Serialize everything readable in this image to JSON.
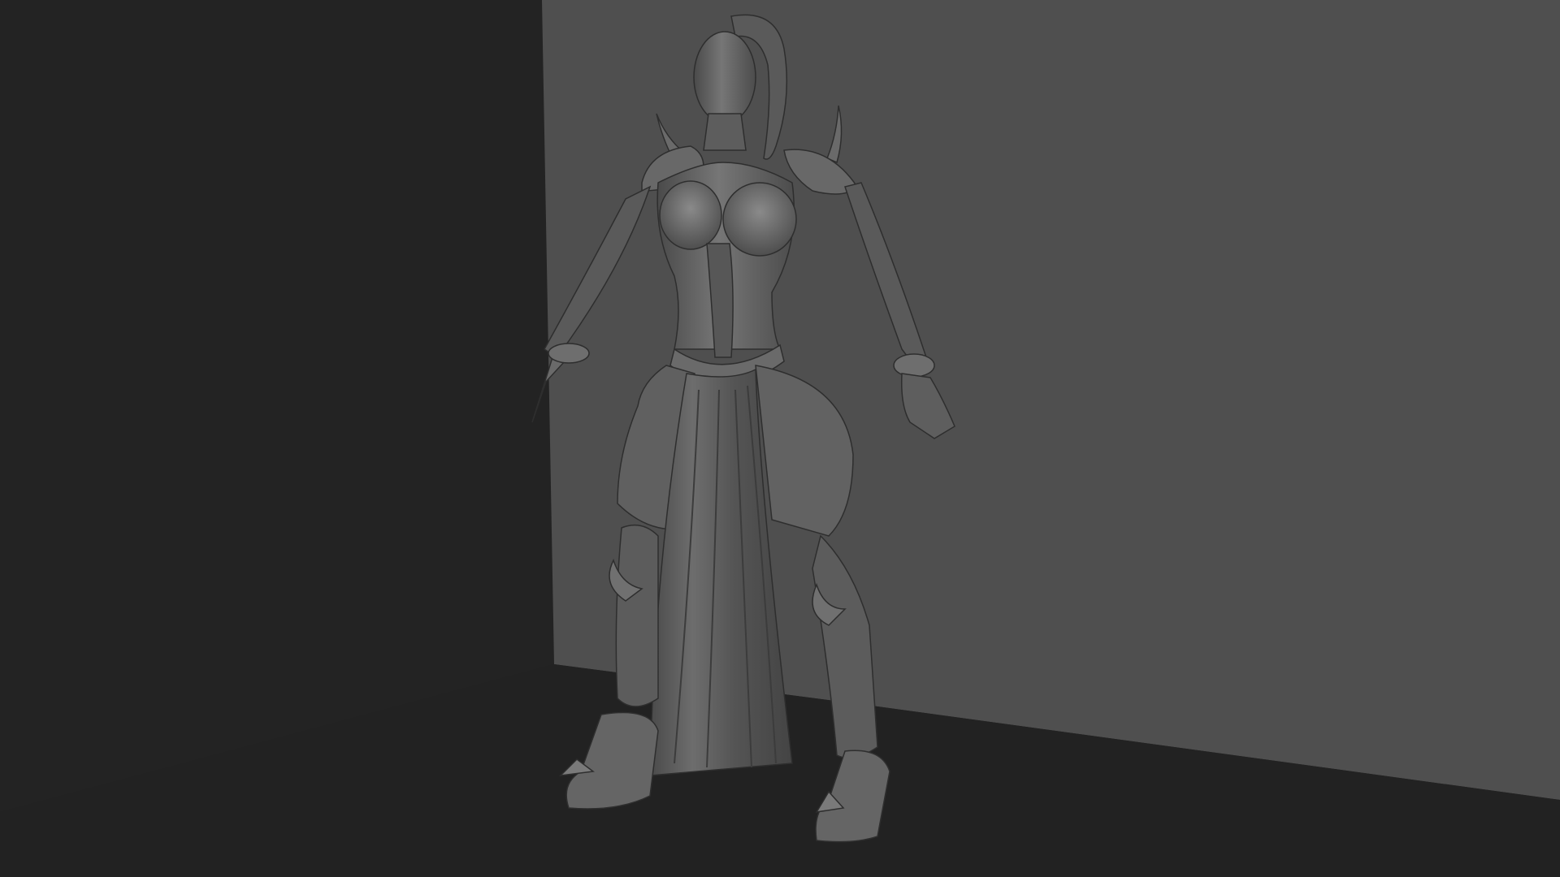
{
  "viewport": {
    "mode": "3d-perspective",
    "shading": "smooth-shaded-grey",
    "subject": "character-sculpt-a-pose",
    "colors": {
      "left_wall": "#232323",
      "back_wall": "#4f4f4f",
      "floor": "#222222",
      "model_base": "#5e5e5e",
      "model_highlight": "#808080",
      "model_shadow": "#3a3a3a"
    }
  }
}
